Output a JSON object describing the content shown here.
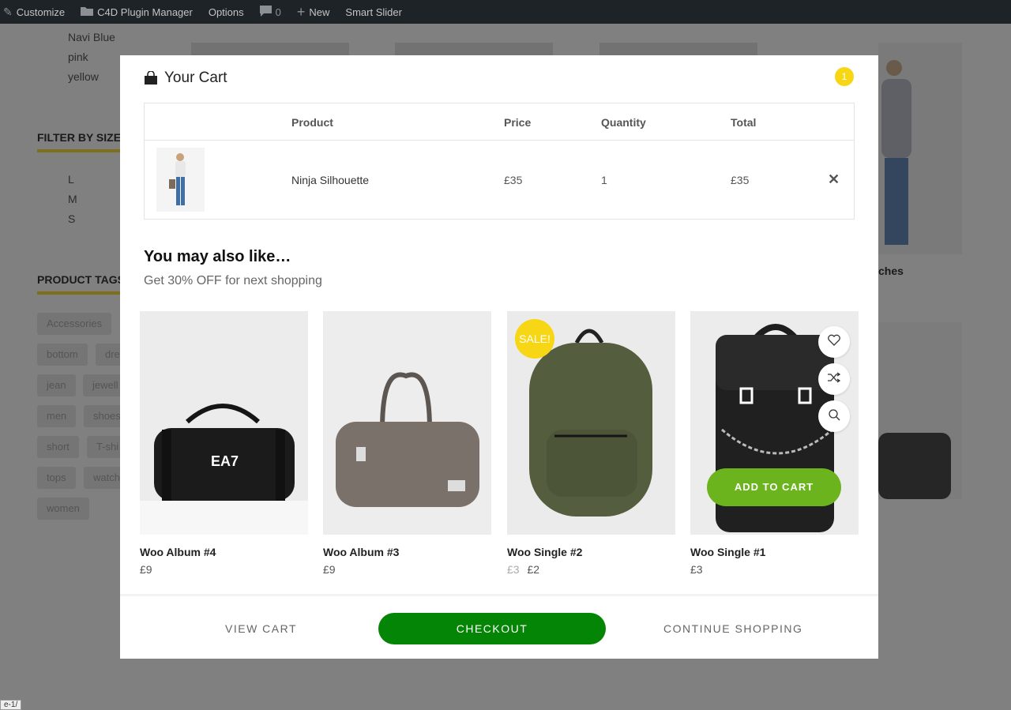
{
  "admin_bar": {
    "customize": "Customize",
    "plugin_manager": "C4D Plugin Manager",
    "options": "Options",
    "comments_count": "0",
    "new": "New",
    "smart_slider": "Smart Slider"
  },
  "background": {
    "colors": [
      "Navi Blue",
      "pink",
      "yellow"
    ],
    "filter_size_heading": "FILTER BY SIZE",
    "sizes": [
      "L",
      "M",
      "S"
    ],
    "product_tags_heading": "PRODUCT TAGS",
    "tags": [
      "Accessories",
      "bottom",
      "dre",
      "jean",
      "jewell",
      "men",
      "shoes",
      "short",
      "T-shi",
      "tops",
      "watch",
      "women"
    ],
    "partial_product_name": "ches",
    "url_tooltip": "e-1/"
  },
  "cart": {
    "title": "Your Cart",
    "item_count": "1",
    "columns": [
      "Product",
      "Price",
      "Quantity",
      "Total"
    ],
    "items": [
      {
        "name": "Ninja Silhouette",
        "price": "£35",
        "quantity": "1",
        "total": "£35"
      }
    ]
  },
  "related": {
    "title": "You may also like…",
    "subtitle": "Get 30% OFF for next shopping",
    "sale_label": "SALE!",
    "add_to_cart_label": "ADD TO CART",
    "products": [
      {
        "name": "Woo Album #4",
        "price": "£9"
      },
      {
        "name": "Woo Album #3",
        "price": "£9"
      },
      {
        "name": "Woo Single #2",
        "old_price": "£3",
        "price": "£2"
      },
      {
        "name": "Woo Single #1",
        "price": "£3"
      }
    ]
  },
  "footer": {
    "view_cart": "VIEW CART",
    "checkout": "CHECKOUT",
    "continue_shopping": "CONTINUE SHOPPING"
  },
  "colors": {
    "accent_yellow": "#f7d616",
    "checkout_green": "#058505",
    "add_to_cart_green": "#6bb41e"
  }
}
